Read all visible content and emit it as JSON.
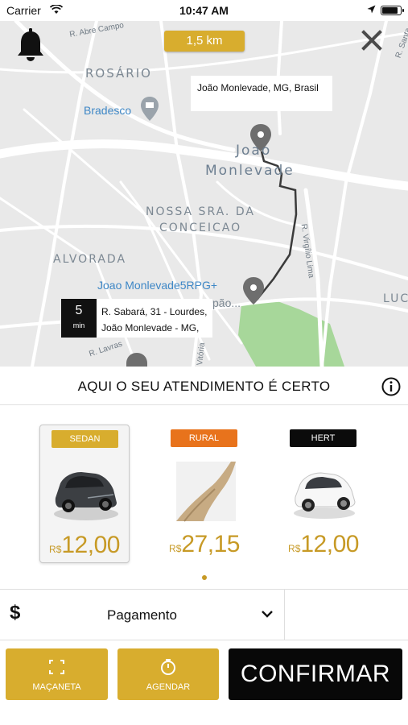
{
  "status_bar": {
    "carrier": "Carrier",
    "time": "10:47 AM"
  },
  "map": {
    "distance": "1,5 km",
    "destination": "João Monlevade, MG, Brasil",
    "origin_eta": {
      "value": "5",
      "unit": "min"
    },
    "origin_address": [
      "R. Sabará, 31 - Lourdes,",
      "João Monlevade - MG,"
    ],
    "neighborhoods": [
      "ROSÁRIO",
      "NOSSA SRA. DA",
      "CONCEICAO",
      "ALVORADA",
      "Joao",
      "Monlevade",
      "LUC"
    ],
    "streets": [
      "R. Abre Campo",
      "R. Santa",
      "R. Virgílio Lima",
      "R. Lavras",
      "Vitória"
    ],
    "pois": [
      "Bradesco",
      "Joao Monlevade5RPG+",
      "pão..."
    ]
  },
  "tagline": "AQUI O SEU ATENDIMENTO É CERTO",
  "vehicles": [
    {
      "category": "SEDAN",
      "currency": "R$",
      "price": "12,00",
      "badge_bg": "#d8ad2e",
      "badge_fg": "#ffffff",
      "selected": true
    },
    {
      "category": "RURAL",
      "currency": "R$",
      "price": "27,15",
      "badge_bg": "#e8731c",
      "badge_fg": "#ffffff",
      "selected": false
    },
    {
      "category": "HERT",
      "currency": "R$",
      "price": "12,00",
      "badge_bg": "#0b0b0b",
      "badge_fg": "#ffffff",
      "selected": false
    }
  ],
  "payment": {
    "symbol": "$",
    "label": "Pagamento"
  },
  "actions": {
    "macaneta": "MAÇANETA",
    "agendar": "AGENDAR",
    "confirm": "CONFIRMAR"
  },
  "icons": {
    "bell": "bell-icon",
    "close": "close-icon",
    "info": "info-icon",
    "dollar": "dollar-icon",
    "chevron": "chevron-down-icon",
    "macaneta": "expand-icon",
    "agendar": "stopwatch-icon",
    "map_pin": "map-pin-icon"
  },
  "colors": {
    "accent": "#d8ad2e",
    "price": "#c79a26",
    "confirm_bg": "#080808",
    "park": "#a7d79a"
  }
}
